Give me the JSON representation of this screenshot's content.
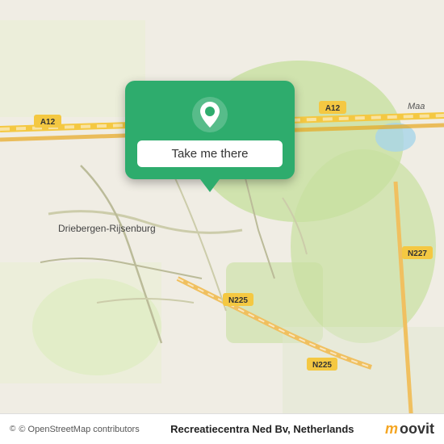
{
  "map": {
    "background_color": "#f0ede4",
    "center_label": "Driebergen-Rijsenburg",
    "road_labels": [
      "A12",
      "A12",
      "N225",
      "N225",
      "N227",
      "Maa"
    ],
    "attribution": "© OpenStreetMap contributors"
  },
  "popup": {
    "button_label": "Take me there",
    "background_color": "#2eac6d"
  },
  "footer": {
    "location_name": "Recreatiecentra Ned Bv, Netherlands",
    "attribution": "© OpenStreetMap contributors",
    "brand": "moovit"
  }
}
